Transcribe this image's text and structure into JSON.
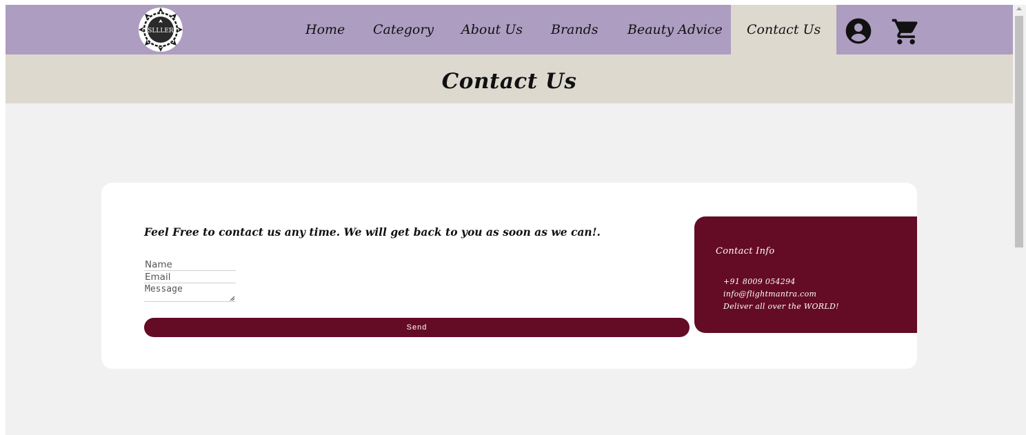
{
  "brand": {
    "logo_text": "SLLLER"
  },
  "nav": {
    "items": [
      {
        "label": "Home"
      },
      {
        "label": "Category"
      },
      {
        "label": "About Us"
      },
      {
        "label": "Brands"
      },
      {
        "label": "Beauty Advice"
      },
      {
        "label": "Contact Us",
        "active": true
      }
    ],
    "icons": [
      "account-circle-icon",
      "shopping-cart-icon"
    ]
  },
  "page": {
    "title": "Contact Us"
  },
  "form": {
    "tagline": "Feel Free to contact us any time. We will get back to you as soon as we can!.",
    "name_placeholder": "Name",
    "email_placeholder": "Email",
    "message_placeholder": "Message",
    "send_label": "Send"
  },
  "contact_info": {
    "title": "Contact Info",
    "phone": "+91 8009 054294",
    "email": "info@flightmantra.com",
    "shipping": "Deliver all over the WORLD!"
  },
  "colors": {
    "nav_bg": "#ad9dc1",
    "band_bg": "#ddd9cf",
    "accent": "#640b25",
    "page_bg": "#f1f1f1"
  }
}
